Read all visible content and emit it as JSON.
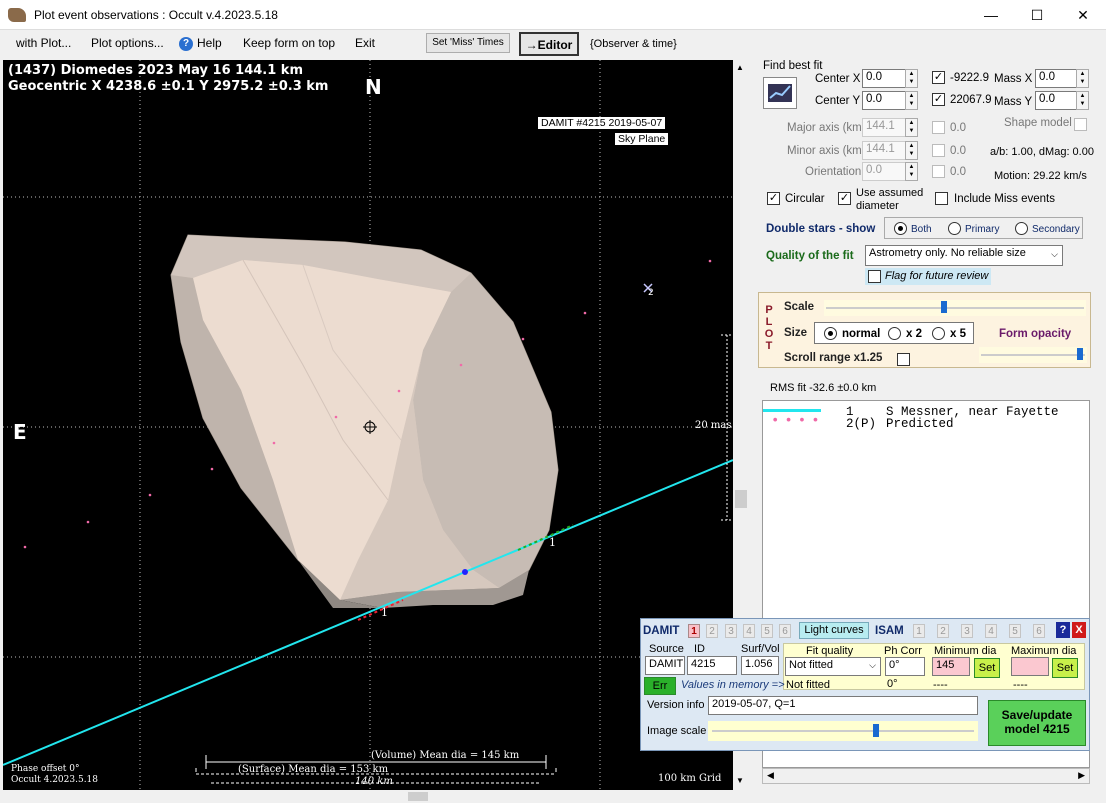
{
  "window": {
    "title": "Plot event observations : Occult v.4.2023.5.18",
    "minimize": "—",
    "maximize": "☐",
    "close": "✕"
  },
  "menu": {
    "with_plot": "with Plot...",
    "plot_options": "Plot options...",
    "help": "Help",
    "keep_on_top": "Keep form on top",
    "exit": "Exit",
    "set_miss_times": "Set 'Miss' Times",
    "editor": "→Editor",
    "observer_time": "{Observer & time}"
  },
  "plot": {
    "header_line1": "(1437) Diomedes  2023 May 16   144.1 km",
    "header_line2": "Geocentric  X  4238.6 ±0.1  Y 2975.2 ±0.3 km",
    "north": "N",
    "east": "E",
    "damit_label": "DAMIT #4215 2019-05-07",
    "sky_plane": "Sky Plane",
    "scale_label": "20 mas",
    "chord_label1": "1",
    "chord_label2": "1",
    "star_label": "2",
    "phase_offset": "Phase offset 0°",
    "version": "Occult 4.2023.5.18",
    "volume_dia": "(Volume) Mean dia = 145 km",
    "surface_dia": "(Surface) Mean dia = 153 km",
    "scale_140": "140 km",
    "grid": "100 km Grid"
  },
  "fit": {
    "find_best_fit": "Find best fit",
    "center_x_label": "Center X",
    "center_x": "0.0",
    "center_y_label": "Center Y",
    "center_y": "0.0",
    "mass_x_val": "-9222.9",
    "mass_x_label": "Mass X",
    "mass_x": "0.0",
    "mass_y_val": "22067.9",
    "mass_y_label": "Mass Y",
    "mass_y": "0.0",
    "major_label": "Major axis (km)",
    "major": "144.1",
    "major_fit": "0.0",
    "minor_label": "Minor axis (km)",
    "minor": "144.1",
    "minor_fit": "0.0",
    "orient_label": "Orientation",
    "orient": "0.0",
    "orient_fit": "0.0",
    "shape_model": "Shape model",
    "ab_dmag": "a/b: 1.00, dMag: 0.00",
    "motion": "Motion: 29.22 km/s",
    "circular": "Circular",
    "use_assumed": "Use assumed",
    "diameter": "diameter",
    "include_miss": "Include Miss events"
  },
  "double": {
    "label": "Double stars - show",
    "both": "Both",
    "primary": "Primary",
    "secondary": "Secondary"
  },
  "quality": {
    "label": "Quality of the fit",
    "value": "Astrometry only. No reliable size",
    "flag": "Flag for future review"
  },
  "plotpanel": {
    "letters": [
      "P",
      "L",
      "O",
      "T"
    ],
    "scale": "Scale",
    "size": "Size",
    "normal": "normal",
    "x2": "x 2",
    "x5": "x 5",
    "form_opacity": "Form opacity",
    "scroll_range": "Scroll range x1.25"
  },
  "rms": "RMS fit -32.6 ±0.0 km",
  "legend": [
    {
      "num": "1",
      "text": "S Messner, near Fayette"
    },
    {
      "num": "2(P)",
      "text": "Predicted"
    }
  ],
  "damit": {
    "damit_label": "DAMIT",
    "tabs": [
      "1",
      "2",
      "3",
      "4",
      "5",
      "6"
    ],
    "light_curves": "Light curves",
    "isam_label": "ISAM",
    "isam_tabs": [
      "1",
      "2",
      "3",
      "4",
      "5",
      "6"
    ],
    "help": "?",
    "close": "X",
    "source_label": "Source",
    "id_label": "ID",
    "surf_label": "Surf/Vol",
    "source": "DAMIT",
    "id": "4215",
    "surf": "1.056",
    "fit_quality_label": "Fit quality",
    "fit_quality": "Not fitted",
    "fit_quality_mem": "Not fitted",
    "ph_corr_label": "Ph Corr",
    "ph_corr": "0°",
    "ph_corr_mem": "0°",
    "min_dia_label": "Minimum dia",
    "min_dia": "145",
    "min_dia_mem": "----",
    "max_dia_label": "Maximum dia",
    "max_dia": "",
    "max_dia_mem": "----",
    "set": "Set",
    "err": "Err",
    "values_mem": "Values in memory =>",
    "version_label": "Version info",
    "version": "2019-05-07, Q=1",
    "image_scale": "Image scale",
    "save_line1": "Save/update",
    "save_line2": "model 4215"
  }
}
